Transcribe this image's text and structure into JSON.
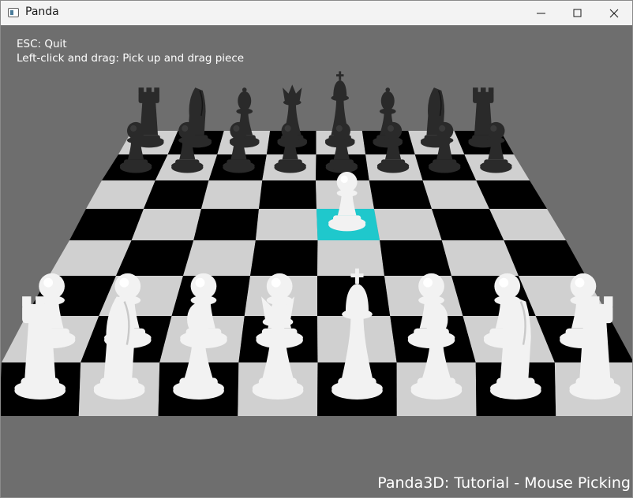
{
  "window": {
    "title": "Panda"
  },
  "titlebar_icons": [
    "app-icon",
    "minimize-icon",
    "maximize-icon",
    "close-icon"
  ],
  "instructions": {
    "quit": "ESC: Quit",
    "drag": "Left-click and drag: Pick up and drag piece"
  },
  "footer": "Panda3D: Tutorial - Mouse Picking",
  "colors": {
    "background": "#6e6e6e",
    "light_square": "#d0d0d0",
    "dark_square": "#000000",
    "highlight_square": "#1fc8cc",
    "black_piece": "#2a2a2a",
    "white_piece": "#f2f2f2"
  },
  "board": {
    "files": [
      "a",
      "b",
      "c",
      "d",
      "e",
      "f",
      "g",
      "h"
    ],
    "ranks": [
      "1",
      "2",
      "3",
      "4",
      "5",
      "6",
      "7",
      "8"
    ],
    "highlighted_square": "e5",
    "pieces": [
      {
        "square": "a8",
        "type": "rook",
        "color": "black"
      },
      {
        "square": "b8",
        "type": "knight",
        "color": "black"
      },
      {
        "square": "c8",
        "type": "bishop",
        "color": "black"
      },
      {
        "square": "d8",
        "type": "queen",
        "color": "black"
      },
      {
        "square": "e8",
        "type": "king",
        "color": "black"
      },
      {
        "square": "f8",
        "type": "bishop",
        "color": "black"
      },
      {
        "square": "g8",
        "type": "knight",
        "color": "black"
      },
      {
        "square": "h8",
        "type": "rook",
        "color": "black"
      },
      {
        "square": "a7",
        "type": "pawn",
        "color": "black"
      },
      {
        "square": "b7",
        "type": "pawn",
        "color": "black"
      },
      {
        "square": "c7",
        "type": "pawn",
        "color": "black"
      },
      {
        "square": "d7",
        "type": "pawn",
        "color": "black"
      },
      {
        "square": "e7",
        "type": "pawn",
        "color": "black"
      },
      {
        "square": "f7",
        "type": "pawn",
        "color": "black"
      },
      {
        "square": "g7",
        "type": "pawn",
        "color": "black"
      },
      {
        "square": "h7",
        "type": "pawn",
        "color": "black"
      },
      {
        "square": "e5",
        "type": "pawn",
        "color": "white"
      },
      {
        "square": "a2",
        "type": "pawn",
        "color": "white"
      },
      {
        "square": "b2",
        "type": "pawn",
        "color": "white"
      },
      {
        "square": "c2",
        "type": "pawn",
        "color": "white"
      },
      {
        "square": "d2",
        "type": "pawn",
        "color": "white"
      },
      {
        "square": "f2",
        "type": "pawn",
        "color": "white"
      },
      {
        "square": "g2",
        "type": "pawn",
        "color": "white"
      },
      {
        "square": "h2",
        "type": "pawn",
        "color": "white"
      },
      {
        "square": "a1",
        "type": "rook",
        "color": "white"
      },
      {
        "square": "b1",
        "type": "knight",
        "color": "white"
      },
      {
        "square": "c1",
        "type": "bishop",
        "color": "white"
      },
      {
        "square": "d1",
        "type": "queen",
        "color": "white"
      },
      {
        "square": "e1",
        "type": "king",
        "color": "white"
      },
      {
        "square": "f1",
        "type": "bishop",
        "color": "white"
      },
      {
        "square": "g1",
        "type": "knight",
        "color": "white"
      },
      {
        "square": "h1",
        "type": "rook",
        "color": "white"
      }
    ]
  }
}
